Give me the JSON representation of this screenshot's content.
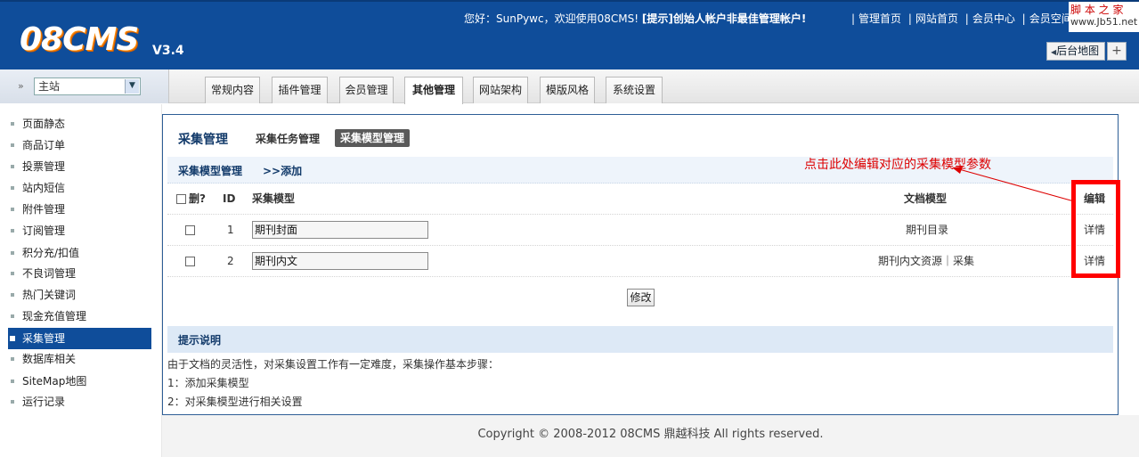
{
  "header": {
    "logo": "08CMS",
    "version": "V3.4",
    "welcome_prefix": "您好：",
    "username": "SunPywc",
    "welcome_suffix": "，欢迎使用08CMS!",
    "tip": "[提示]创始人帐户非最佳管理帐户!",
    "links": [
      "管理首页",
      "网站首页",
      "会员中心",
      "会员空间"
    ],
    "sitemap_button": "后台地图",
    "plus_button": "+"
  },
  "watermark": {
    "line1": "脚 本 之 家",
    "line2": "www.Jb51.net"
  },
  "site_select": {
    "value": "主站"
  },
  "tabs": [
    "常规内容",
    "插件管理",
    "会员管理",
    "其他管理",
    "网站架构",
    "模版风格",
    "系统设置"
  ],
  "active_tab": "其他管理",
  "sidebar": {
    "items": [
      "页面静态",
      "商品订单",
      "投票管理",
      "站内短信",
      "附件管理",
      "订阅管理",
      "积分充/扣值",
      "不良词管理",
      "热门关键词",
      "现金充值管理",
      "采集管理",
      "数据库相关",
      "SiteMap地图",
      "运行记录"
    ],
    "active": "采集管理"
  },
  "main": {
    "title": "采集管理",
    "sub_tabs": [
      "采集任务管理",
      "采集模型管理"
    ],
    "section_title": "采集模型管理",
    "add_link": ">>添加",
    "annotation": "点击此处编辑对应的采集模型参数",
    "table": {
      "headers": [
        "删?",
        "ID",
        "采集模型",
        "文档模型",
        "编辑"
      ],
      "rows": [
        {
          "id": "1",
          "name": "期刊封面",
          "doc_model": "期刊目录",
          "edit": "详情"
        },
        {
          "id": "2",
          "name": "期刊内文",
          "doc_model": "期刊内文资源｜采集",
          "edit": "详情"
        }
      ]
    },
    "submit": "修改",
    "tips_title": "提示说明",
    "tips": [
      "由于文档的灵活性，对采集设置工作有一定难度，采集操作基本步骤：",
      "1：添加采集模型",
      "2：对采集模型进行相关设置"
    ]
  },
  "footer": "Copyright © 2008-2012 08CMS 鼎越科技 All rights reserved.",
  "colors": {
    "header_bg": "#0f4d9a",
    "active_sidebar": "#0f4d9a",
    "annotation": "#dd0000",
    "highlight_box": "#ff0000"
  }
}
